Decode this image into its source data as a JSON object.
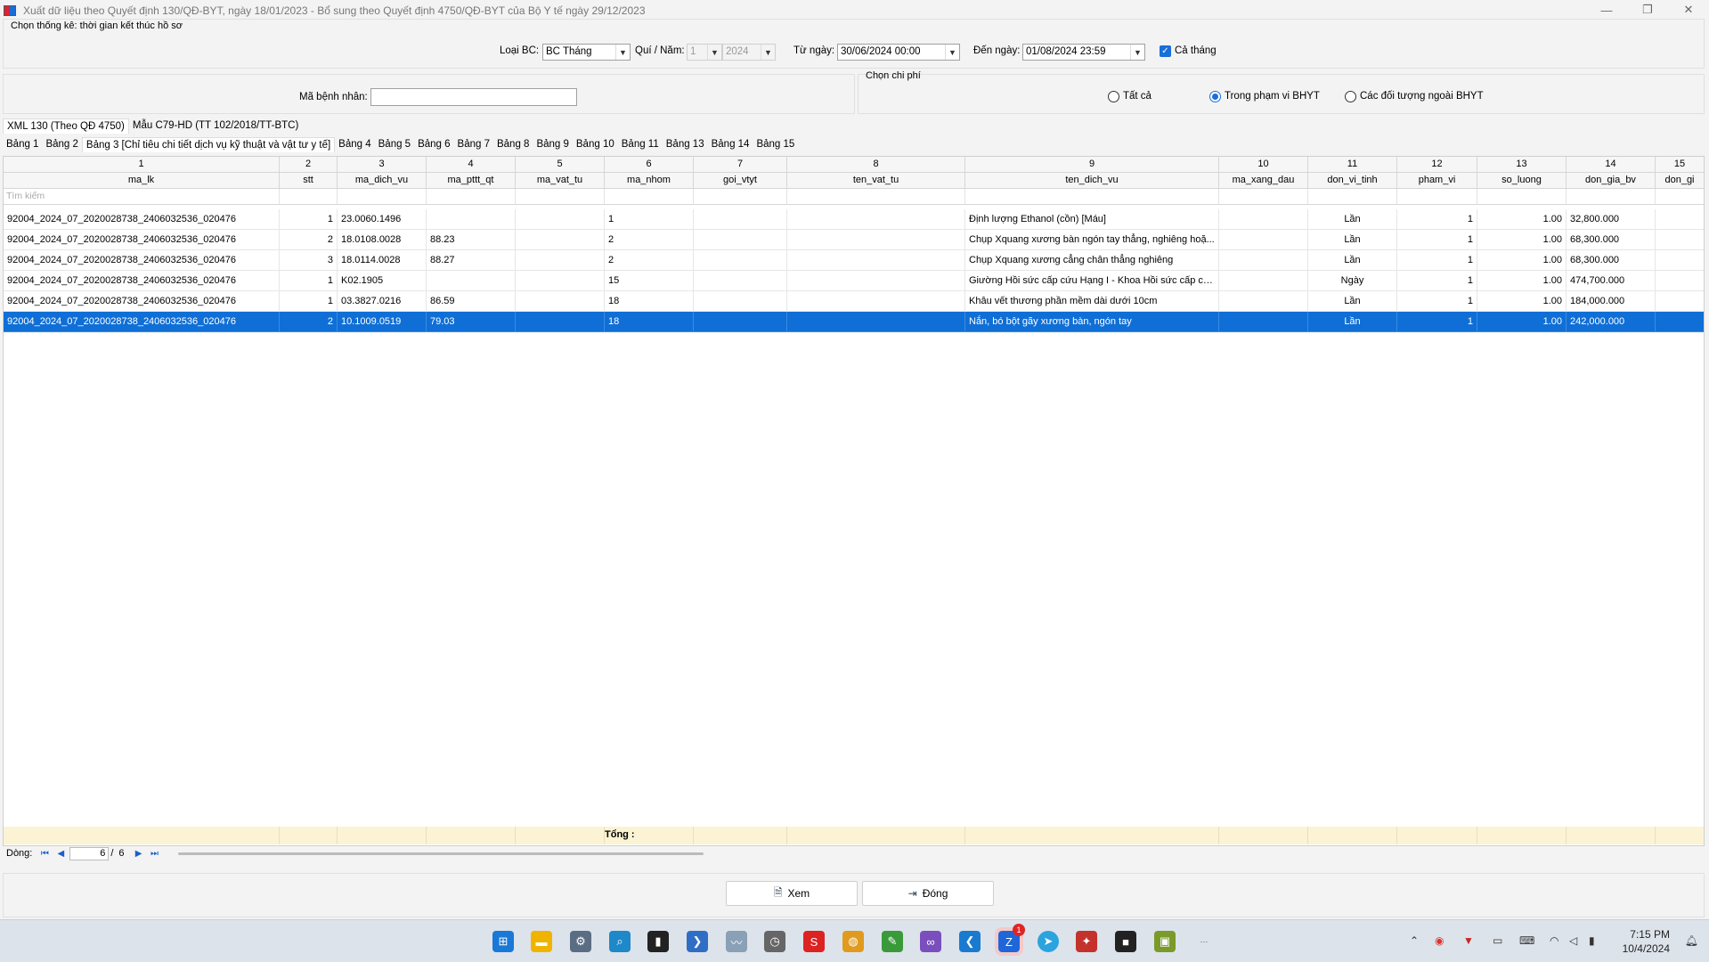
{
  "window": {
    "title": "Xuất dữ liệu theo Quyết định 130/QĐ-BYT, ngày 18/01/2023 - Bổ sung theo Quyết định 4750/QĐ-BYT của Bộ Y tế ngày 29/12/2023",
    "controls": [
      "—",
      "❐",
      "✕"
    ]
  },
  "filter": {
    "header": "Chọn thống kê: thời gian kết thúc hồ sơ",
    "loai_bc_label": "Loại BC:",
    "loai_bc_value": "BC Tháng",
    "quy_nam_label": "Quí / Năm:",
    "quy_value": "1",
    "nam_value": "2024",
    "tu_ngay_label": "Từ ngày:",
    "tu_ngay_value": "30/06/2024 00:00",
    "den_ngay_label": "Đến ngày:",
    "den_ngay_value": "01/08/2024 23:59",
    "ca_thang_label": "Cả tháng",
    "ma_benh_nhan_label": "Mã bệnh nhân:",
    "ma_benh_nhan_value": "",
    "chi_phi_group": "Chọn chi phí",
    "radio_all": "Tất cả",
    "radio_bhyt": "Trong phạm vi BHYT",
    "radio_ngoai": "Các đối tượng ngoài BHYT"
  },
  "outer_tabs": [
    "XML 130 (Theo QĐ 4750)",
    "Mẫu C79-HD (TT 102/2018/TT-BTC)"
  ],
  "inner_tabs": [
    "Bảng 1",
    "Bảng 2",
    "Bảng 3 [Chỉ tiêu chi tiết dịch vụ kỹ thuật và vật tư y tế]",
    "Bảng 4",
    "Bảng 5",
    "Bảng 6",
    "Bảng 7",
    "Bảng 8",
    "Bảng 9",
    "Bảng 10",
    "Bảng 11",
    "Bảng 13",
    "Bảng 14",
    "Bảng 15"
  ],
  "grid": {
    "numbers": [
      "1",
      "2",
      "3",
      "4",
      "5",
      "6",
      "7",
      "8",
      "9",
      "10",
      "11",
      "12",
      "13",
      "14",
      "15"
    ],
    "columns": [
      "ma_lk",
      "stt",
      "ma_dich_vu",
      "ma_pttt_qt",
      "ma_vat_tu",
      "ma_nhom",
      "goi_vtyt",
      "ten_vat_tu",
      "ten_dich_vu",
      "ma_xang_dau",
      "don_vi_tinh",
      "pham_vi",
      "so_luong",
      "don_gia_bv",
      "don_gi"
    ],
    "search_placeholder": "Tìm kiếm",
    "rows": [
      [
        "92004_2024_07_2020028738_2406032536_020476",
        "1",
        "23.0060.1496",
        "",
        "",
        "1",
        "",
        "",
        "Định lượng Ethanol (cồn) [Máu]",
        "",
        "Lần",
        "1",
        "1.00",
        "32,800.000",
        ""
      ],
      [
        "92004_2024_07_2020028738_2406032536_020476",
        "2",
        "18.0108.0028",
        "88.23",
        "",
        "2",
        "",
        "",
        "Chụp Xquang xương bàn ngón tay thẳng, nghiêng hoặ...",
        "",
        "Lần",
        "1",
        "1.00",
        "68,300.000",
        ""
      ],
      [
        "92004_2024_07_2020028738_2406032536_020476",
        "3",
        "18.0114.0028",
        "88.27",
        "",
        "2",
        "",
        "",
        "Chụp Xquang xương cẳng chân thẳng nghiêng",
        "",
        "Lần",
        "1",
        "1.00",
        "68,300.000",
        ""
      ],
      [
        "92004_2024_07_2020028738_2406032536_020476",
        "1",
        "K02.1905",
        "",
        "",
        "15",
        "",
        "",
        "Giường Hồi sức cấp cứu Hạng I - Khoa Hồi sức cấp cứu",
        "",
        "Ngày",
        "1",
        "1.00",
        "474,700.000",
        ""
      ],
      [
        "92004_2024_07_2020028738_2406032536_020476",
        "1",
        "03.3827.0216",
        "86.59",
        "",
        "18",
        "",
        "",
        "Khâu vết thương phần mềm dài dưới 10cm",
        "",
        "Lần",
        "1",
        "1.00",
        "184,000.000",
        ""
      ],
      [
        "92004_2024_07_2020028738_2406032536_020476",
        "2",
        "10.1009.0519",
        "79.03",
        "",
        "18",
        "",
        "",
        "Nắn, bó bột gãy xương bàn, ngón tay",
        "",
        "Lần",
        "1",
        "1.00",
        "242,000.000",
        ""
      ]
    ],
    "selected_row": 5,
    "total_label": "Tổng :"
  },
  "navigator": {
    "label": "Dòng:",
    "current": "6",
    "sep": "/",
    "total": "6"
  },
  "buttons": {
    "xem": "Xem",
    "dong": "Đóng"
  },
  "taskbar": {
    "time": "7:15 PM",
    "date": "10/4/2024",
    "zalo_badge": "1"
  },
  "colors": {
    "selection": "#0f6fd6",
    "footer": "#fbf3d3"
  }
}
